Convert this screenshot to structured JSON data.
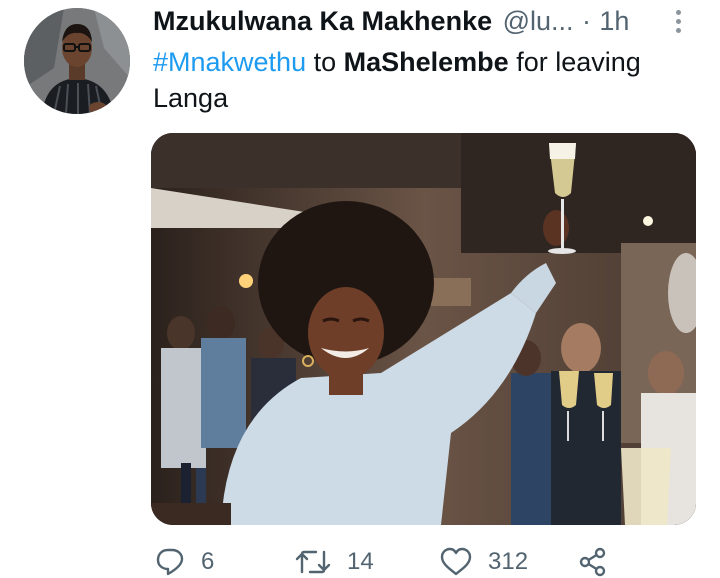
{
  "tweet": {
    "display_name": "Mzukulwana Ka Makhenke",
    "handle": "@lu...",
    "separator": "·",
    "time": "1h",
    "text": {
      "hashtag": "#Mnakwethu",
      "part1": " to ",
      "bold": "MaShelembe",
      "part2": " for leaving Langa"
    },
    "media": {
      "description_icon": "photo-image"
    },
    "actions": {
      "replies": "6",
      "retweets": "14",
      "likes": "312"
    }
  },
  "colors": {
    "hashtag": "#1d9bf0",
    "secondary_text": "#536471",
    "primary_text": "#0f1419"
  }
}
